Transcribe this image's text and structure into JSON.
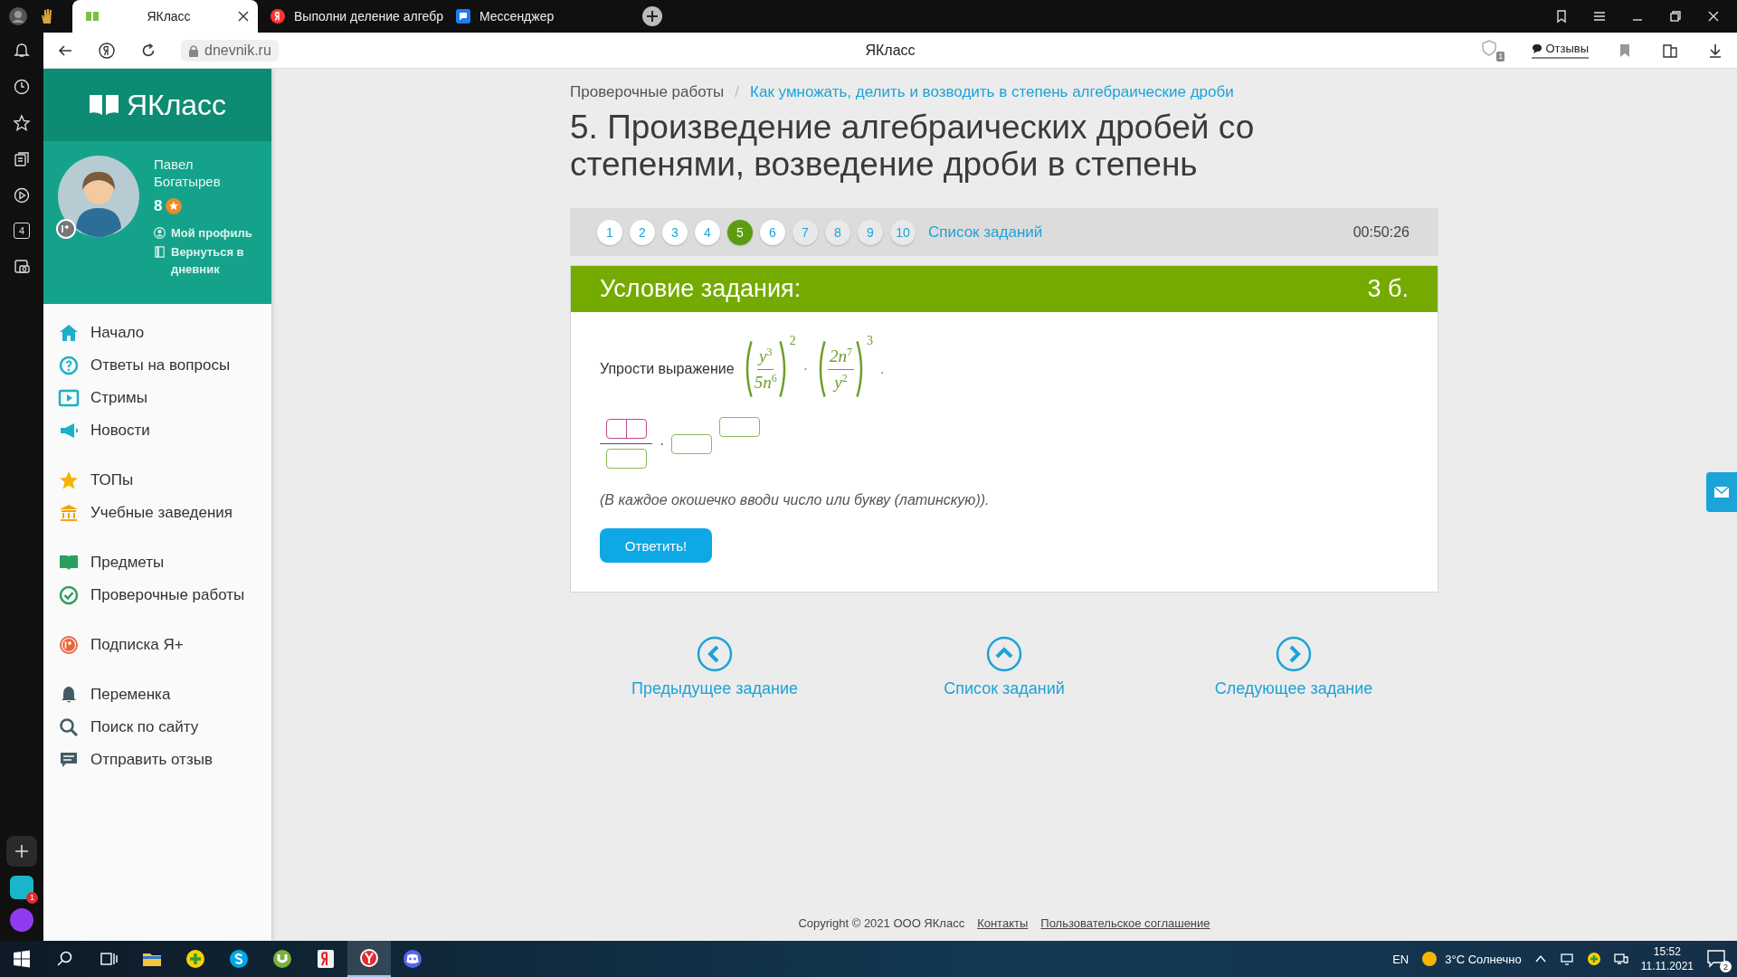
{
  "browser": {
    "tabs": [
      {
        "title": "ЯКласс",
        "selected": true,
        "kind": "yaklass"
      },
      {
        "title": "Выполни деление алгебр",
        "selected": false,
        "kind": "yandex"
      },
      {
        "title": "Мессенджер",
        "selected": false,
        "kind": "messenger"
      }
    ],
    "address": "dnevnik.ru",
    "page_title": "ЯКласс",
    "shield_count": "1",
    "feedback": "Отзывы",
    "rail_counter": "4",
    "rail_badge": "1"
  },
  "sidebar": {
    "logo": "ЯКласс",
    "user": {
      "name": "Павел Богатырев",
      "points": "8",
      "links": [
        {
          "label": "Мой профиль",
          "kind": "profile"
        },
        {
          "label": "Вернуться в дневник",
          "kind": "diary"
        }
      ]
    },
    "groups": [
      {
        "items": [
          {
            "label": "Начало",
            "kind": "home"
          },
          {
            "label": "Ответы на вопросы",
            "kind": "question"
          },
          {
            "label": "Стримы",
            "kind": "stream"
          },
          {
            "label": "Новости",
            "kind": "news"
          }
        ]
      },
      {
        "items": [
          {
            "label": "ТОПы",
            "kind": "star"
          },
          {
            "label": "Учебные заведения",
            "kind": "school"
          }
        ]
      },
      {
        "items": [
          {
            "label": "Предметы",
            "kind": "book"
          },
          {
            "label": "Проверочные работы",
            "kind": "check"
          }
        ]
      },
      {
        "items": [
          {
            "label": "Подписка Я+",
            "kind": "plus"
          }
        ]
      },
      {
        "items": [
          {
            "label": "Переменка",
            "kind": "bell"
          },
          {
            "label": "Поиск по сайту",
            "kind": "search"
          },
          {
            "label": "Отправить отзыв",
            "kind": "chat"
          }
        ]
      }
    ]
  },
  "breadcrumbs": [
    {
      "label": "Проверочные работы",
      "kind": "text"
    },
    {
      "label": "Как умножать, делить и возводить в степень алгебраические дроби",
      "kind": "link"
    }
  ],
  "breadcrumb_separator": "/",
  "title": "5. Произведение алгебраических дробей со степенями, возведение дроби в степень",
  "pager": {
    "items": [
      {
        "label": "1",
        "selected": false,
        "visited": true
      },
      {
        "label": "2",
        "selected": false,
        "visited": true
      },
      {
        "label": "3",
        "selected": false,
        "visited": true
      },
      {
        "label": "4",
        "selected": false,
        "visited": true
      },
      {
        "label": "5",
        "selected": true,
        "visited": true
      },
      {
        "label": "6",
        "selected": false,
        "visited": true
      },
      {
        "label": "7",
        "selected": false,
        "visited": false
      },
      {
        "label": "8",
        "selected": false,
        "visited": false
      },
      {
        "label": "9",
        "selected": false,
        "visited": false
      },
      {
        "label": "10",
        "selected": false,
        "visited": false
      }
    ],
    "list_link": "Список заданий",
    "timer": "00:50:26"
  },
  "task": {
    "header": "Условие задания:",
    "points": "3 б.",
    "prompt": "Упрости выражение",
    "expression": {
      "factors": [
        {
          "num_base": "y",
          "num_exp": "3",
          "den_base": "5n",
          "den_exp": "6",
          "power": "2"
        },
        {
          "num_base": "2n",
          "num_exp": "7",
          "den_base": "y",
          "den_exp": "2",
          "power": "3"
        }
      ],
      "operator": "·",
      "end": "."
    },
    "answer": {
      "numerator": {
        "focused": true
      },
      "denominator": {
        "focused": false
      },
      "operator": "·",
      "base": {
        "focused": false
      },
      "exponent": {
        "focused": false
      }
    },
    "hint": "(В каждое окошечко вводи число или букву (латинскую)).",
    "submit": "Ответить!"
  },
  "navigation": [
    {
      "label": "Предыдущее задание",
      "kind": "prev"
    },
    {
      "label": "Список заданий",
      "kind": "up"
    },
    {
      "label": "Следующее задание",
      "kind": "next"
    }
  ],
  "footer": {
    "copyright": "Copyright © 2021 ООО ЯКласс",
    "links": [
      "Контакты",
      "Пользовательское соглашение"
    ]
  },
  "taskbar": {
    "apps": [
      {
        "kind": "explorer",
        "selected": false
      },
      {
        "kind": "plus",
        "selected": false
      },
      {
        "kind": "skype",
        "selected": false
      },
      {
        "kind": "torrent",
        "selected": false
      },
      {
        "kind": "yandex",
        "selected": false
      },
      {
        "kind": "yabrowser",
        "selected": true
      },
      {
        "kind": "discord",
        "selected": false
      }
    ],
    "language": "EN",
    "weather": "3°C Солнечно",
    "time": "15:52",
    "date": "11.11.2021",
    "notifications": "2"
  }
}
